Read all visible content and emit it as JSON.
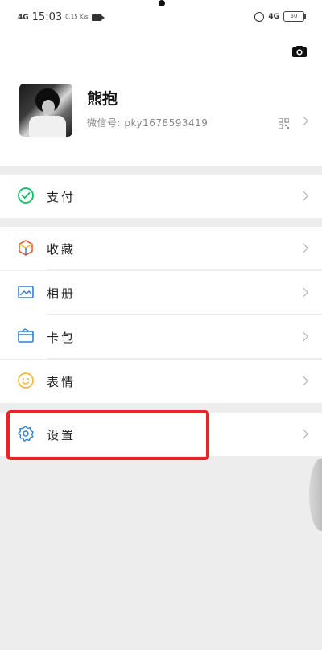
{
  "status_bar": {
    "network_left": "4G",
    "time": "15:03",
    "speed": "0.15 K/s",
    "network_right": "4G",
    "battery": "50"
  },
  "profile": {
    "nickname": "熊抱",
    "wechat_id": "微信号: pky1678593419"
  },
  "menu": [
    {
      "id": "pay",
      "label": "支付",
      "icon": "wechat-pay-icon"
    },
    {
      "id": "favorites",
      "label": "收藏",
      "icon": "cube-icon"
    },
    {
      "id": "album",
      "label": "相册",
      "icon": "image-icon"
    },
    {
      "id": "cards",
      "label": "卡包",
      "icon": "wallet-icon"
    },
    {
      "id": "stickers",
      "label": "表情",
      "icon": "smile-icon"
    },
    {
      "id": "settings",
      "label": "设置",
      "icon": "gear-icon"
    }
  ],
  "colors": {
    "highlight": "#e8232a",
    "wechat_green": "#07c160",
    "blue": "#2f7fd6",
    "yellow": "#f5b73c"
  }
}
